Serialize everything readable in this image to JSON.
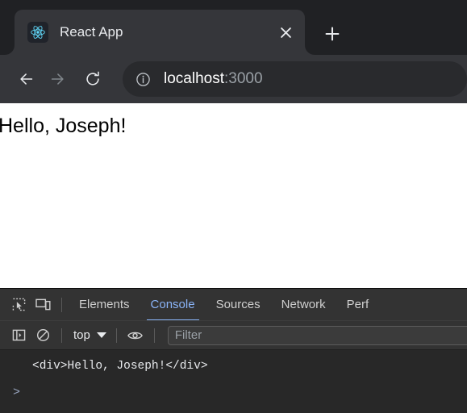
{
  "browser": {
    "tab": {
      "favicon_icon": "react-logo-icon",
      "title": "React App",
      "close_icon": "close-icon"
    },
    "new_tab_icon": "plus-icon",
    "toolbar": {
      "back_icon": "back-arrow-icon",
      "forward_icon": "forward-arrow-icon",
      "reload_icon": "reload-icon",
      "site_info_icon": "info-circle-icon",
      "url_host": "localhost",
      "url_port": ":3000"
    }
  },
  "viewport": {
    "page_text": "Hello, Joseph!"
  },
  "devtools": {
    "inspect_icon": "inspect-element-icon",
    "device_icon": "device-toolbar-icon",
    "tabs": [
      {
        "label": "Elements",
        "active": false
      },
      {
        "label": "Console",
        "active": true
      },
      {
        "label": "Sources",
        "active": false
      },
      {
        "label": "Network",
        "active": false
      },
      {
        "label": "Perf",
        "active": false
      }
    ],
    "console_toolbar": {
      "sidebar_icon": "console-sidebar-icon",
      "clear_icon": "clear-console-icon",
      "context_value": "top",
      "eye_icon": "live-expression-icon",
      "filter_placeholder": "Filter",
      "filter_value": ""
    },
    "console_output": {
      "message": "<div>Hello, Joseph!</div>",
      "prompt_symbol": ">"
    }
  },
  "colors": {
    "tab_strip_bg": "#202124",
    "toolbar_bg": "#35363a",
    "omnibox_bg": "#292a2d",
    "devtools_bg": "#282828",
    "devtools_bar_bg": "#333333",
    "accent_blue": "#8ab4f8",
    "react_cyan": "#61dafb"
  }
}
